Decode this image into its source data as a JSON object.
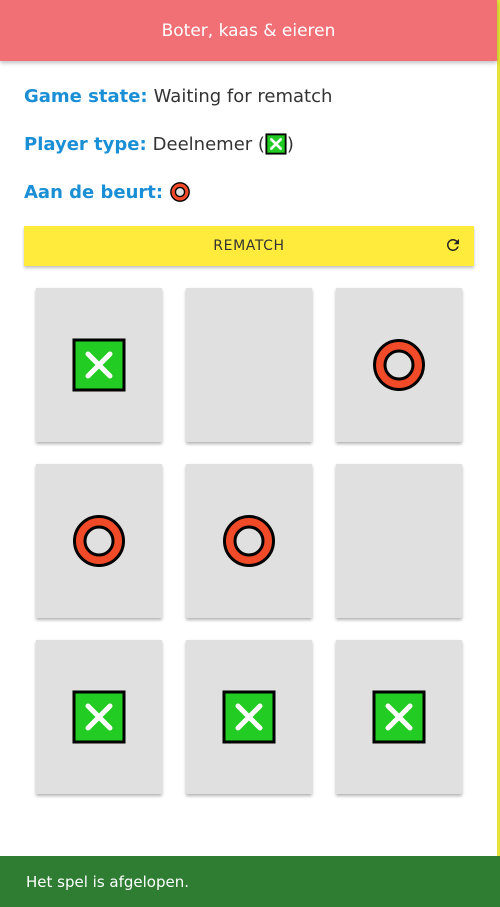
{
  "app": {
    "title": "Boter, kaas & eieren"
  },
  "info": {
    "game_state_label": "Game state:",
    "game_state_value": "Waiting for rematch",
    "player_type_label": "Player type:",
    "player_type_value": "Deelnemer (",
    "player_type_close": ")",
    "player_symbol": "X",
    "turn_label": "Aan de beurt:",
    "turn_symbol": "O"
  },
  "rematch": {
    "label": "REMATCH",
    "icon": "refresh-icon"
  },
  "board": [
    "X",
    "",
    "O",
    "O",
    "O",
    "",
    "X",
    "X",
    "X"
  ],
  "snackbar": {
    "message": "Het spel is afgelopen."
  },
  "colors": {
    "appbar": "#f07075",
    "label_blue": "#1a8fd6",
    "rematch_yellow": "#ffeb3b",
    "cell_gray": "#e0e0e0",
    "x_green": "#22cc22",
    "o_red": "#f04a28",
    "snackbar_green": "#2e7d32"
  }
}
